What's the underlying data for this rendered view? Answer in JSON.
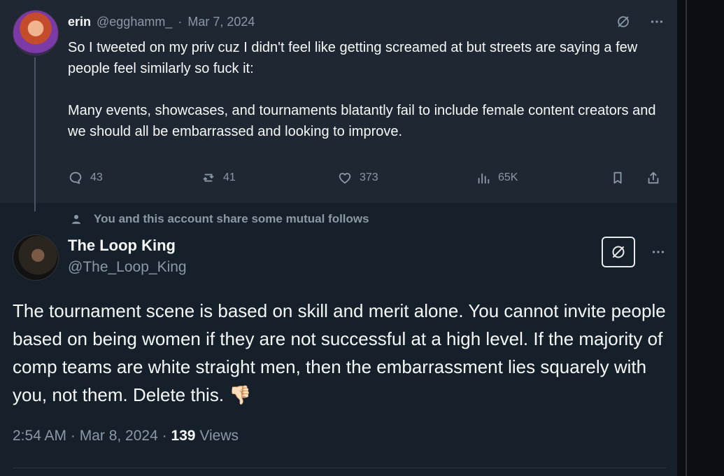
{
  "parent_tweet": {
    "author_name": "erin",
    "author_handle": "@egghamm_",
    "separator": "·",
    "date": "Mar 7, 2024",
    "text": "So I tweeted on my priv cuz I didn't feel like getting screamed at but streets are saying a few people feel similarly so fuck it:\n\nMany events, showcases, and tournaments blatantly fail to include female content creators and we should all be embarrassed and looking to improve.",
    "metrics": {
      "replies": "43",
      "reposts": "41",
      "likes": "373",
      "views": "65K"
    },
    "icons": {
      "more": "ellipsis-icon",
      "grok": "grok-icon",
      "reply": "reply-icon",
      "repost": "repost-icon",
      "like": "heart-icon",
      "views": "views-icon",
      "bookmark": "bookmark-icon",
      "share": "share-icon"
    }
  },
  "context": {
    "mutual_follows_text": "You and this account share some mutual follows",
    "icon": "person-icon"
  },
  "reply_tweet": {
    "author_name": "The Loop King",
    "author_handle": "@The_Loop_King",
    "text": "The tournament scene is based on skill and merit alone. You cannot invite people based on being women if they are not successful at a high level. If the majority of comp teams are white straight men, then the embarrassment lies squarely with you, not them. Delete this. 👎🏻",
    "timestamp": "2:54 AM · Mar 8, 2024 ·",
    "views_count": "139",
    "views_label": "Views",
    "icons": {
      "grok": "grok-icon",
      "more": "ellipsis-icon"
    }
  },
  "colors": {
    "background": "#15202b",
    "parent_background": "#1e2732",
    "text": "#f7f9f9",
    "secondary_text": "#8b98a5",
    "divider": "#2f3336"
  }
}
